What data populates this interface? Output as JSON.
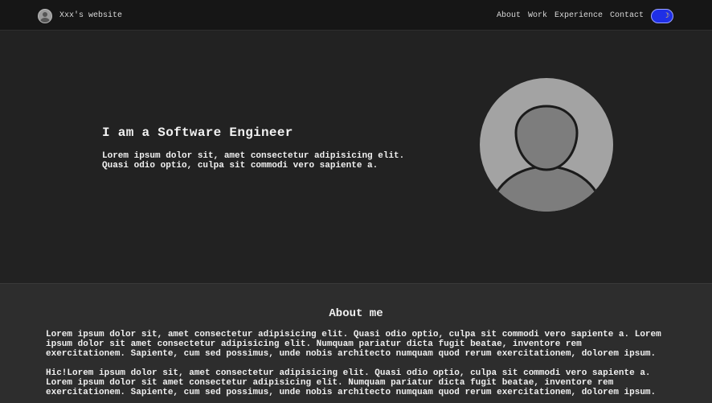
{
  "nav": {
    "site_title": "Xxx's website",
    "links": [
      "About",
      "Work",
      "Experience",
      "Contact"
    ],
    "theme_toggle_icon": "moon-icon",
    "toggle_color": "#1f2fe6"
  },
  "hero": {
    "title": "I am a Software Engineer",
    "line1": "Lorem ipsum dolor sit, amet consectetur adipisicing elit.",
    "line2": "Quasi odio optio, culpa sit commodi vero sapiente a.",
    "portrait_icon": "user-avatar-icon"
  },
  "about": {
    "heading": "About me",
    "para1": "Lorem ipsum dolor sit, amet consectetur adipisicing elit. Quasi odio optio, culpa sit commodi vero sapiente a. Lorem ipsum dolor sit amet consectetur adipisicing elit. Numquam pariatur dicta fugit beatae, inventore rem exercitationem. Sapiente, cum sed possimus, unde nobis architecto numquam quod rerum exercitationem, dolorem ipsum.",
    "para2": "Hic!Lorem ipsum dolor sit, amet consectetur adipisicing elit. Quasi odio optio, culpa sit commodi vero sapiente a. Lorem ipsum dolor sit amet consectetur adipisicing elit. Numquam pariatur dicta fugit beatae, inventore rem exercitationem. Sapiente, cum sed possimus, unde nobis architecto numquam quod rerum exercitationem, dolorem ipsum."
  }
}
